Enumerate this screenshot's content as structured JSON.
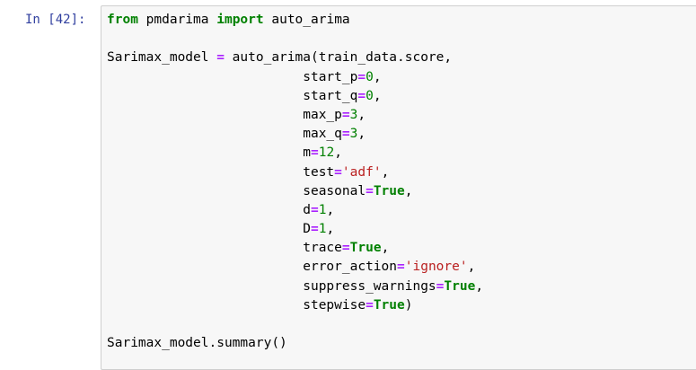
{
  "cell": {
    "prompt": "In [42]:",
    "lines": [
      [
        {
          "t": "from",
          "c": "kw"
        },
        {
          "t": " pmdarima ",
          "c": ""
        },
        {
          "t": "import",
          "c": "kw"
        },
        {
          "t": " auto_arima",
          "c": ""
        }
      ],
      [],
      [
        {
          "t": "Sarimax_model ",
          "c": ""
        },
        {
          "t": "=",
          "c": "op"
        },
        {
          "t": " auto_arima(train_data.score,",
          "c": ""
        }
      ],
      [
        {
          "t": "                         start_p",
          "c": ""
        },
        {
          "t": "=",
          "c": "op"
        },
        {
          "t": "0",
          "c": "num"
        },
        {
          "t": ",",
          "c": ""
        }
      ],
      [
        {
          "t": "                         start_q",
          "c": ""
        },
        {
          "t": "=",
          "c": "op"
        },
        {
          "t": "0",
          "c": "num"
        },
        {
          "t": ",",
          "c": ""
        }
      ],
      [
        {
          "t": "                         max_p",
          "c": ""
        },
        {
          "t": "=",
          "c": "op"
        },
        {
          "t": "3",
          "c": "num"
        },
        {
          "t": ",",
          "c": ""
        }
      ],
      [
        {
          "t": "                         max_q",
          "c": ""
        },
        {
          "t": "=",
          "c": "op"
        },
        {
          "t": "3",
          "c": "num"
        },
        {
          "t": ",",
          "c": ""
        }
      ],
      [
        {
          "t": "                         m",
          "c": ""
        },
        {
          "t": "=",
          "c": "op"
        },
        {
          "t": "12",
          "c": "num"
        },
        {
          "t": ",",
          "c": ""
        }
      ],
      [
        {
          "t": "                         test",
          "c": ""
        },
        {
          "t": "=",
          "c": "op"
        },
        {
          "t": "'adf'",
          "c": "str"
        },
        {
          "t": ",",
          "c": ""
        }
      ],
      [
        {
          "t": "                         seasonal",
          "c": ""
        },
        {
          "t": "=",
          "c": "op"
        },
        {
          "t": "True",
          "c": "kw"
        },
        {
          "t": ",",
          "c": ""
        }
      ],
      [
        {
          "t": "                         d",
          "c": ""
        },
        {
          "t": "=",
          "c": "op"
        },
        {
          "t": "1",
          "c": "num"
        },
        {
          "t": ",",
          "c": ""
        }
      ],
      [
        {
          "t": "                         D",
          "c": ""
        },
        {
          "t": "=",
          "c": "op"
        },
        {
          "t": "1",
          "c": "num"
        },
        {
          "t": ",",
          "c": ""
        }
      ],
      [
        {
          "t": "                         trace",
          "c": ""
        },
        {
          "t": "=",
          "c": "op"
        },
        {
          "t": "True",
          "c": "kw"
        },
        {
          "t": ",",
          "c": ""
        }
      ],
      [
        {
          "t": "                         error_action",
          "c": ""
        },
        {
          "t": "=",
          "c": "op"
        },
        {
          "t": "'ignore'",
          "c": "str"
        },
        {
          "t": ",",
          "c": ""
        }
      ],
      [
        {
          "t": "                         suppress_warnings",
          "c": ""
        },
        {
          "t": "=",
          "c": "op"
        },
        {
          "t": "True",
          "c": "kw"
        },
        {
          "t": ",",
          "c": ""
        }
      ],
      [
        {
          "t": "                         stepwise",
          "c": ""
        },
        {
          "t": "=",
          "c": "op"
        },
        {
          "t": "True",
          "c": "kw"
        },
        {
          "t": ")",
          "c": ""
        }
      ],
      [],
      [
        {
          "t": "Sarimax_model.summary()",
          "c": ""
        }
      ]
    ]
  },
  "colors": {
    "prompt": "#303f9f",
    "keyword": "#008000",
    "operator": "#aa22ff",
    "number": "#008000",
    "string": "#ba2121",
    "cell_background": "#f7f7f7",
    "cell_border": "#cfcfcf"
  }
}
